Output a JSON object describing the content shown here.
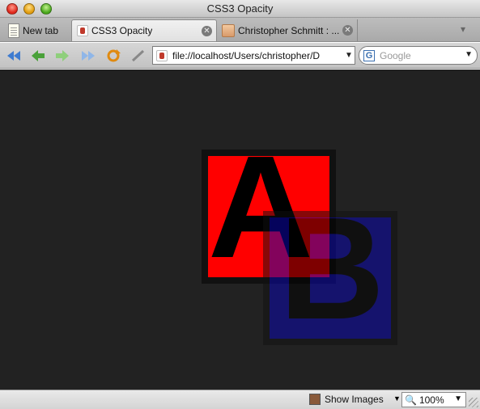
{
  "window": {
    "title": "CSS3 Opacity"
  },
  "tabs": [
    {
      "label": "New tab",
      "icon": "new-tab-icon"
    },
    {
      "label": "CSS3 Opacity",
      "icon": "page-favicon",
      "active": true
    },
    {
      "label": "Christopher Schmitt : ...",
      "icon": "page-favicon"
    }
  ],
  "toolbar": {
    "url": "file://localhost/Users/christopher/D",
    "search_placeholder": "Google"
  },
  "content": {
    "background": "#222222",
    "box_a": {
      "letter": "A",
      "color": "#ff0000"
    },
    "box_b": {
      "letter": "B",
      "color": "#0a06b8",
      "opacity": 0.5
    }
  },
  "statusbar": {
    "show_images": "Show Images",
    "zoom": "100%"
  }
}
